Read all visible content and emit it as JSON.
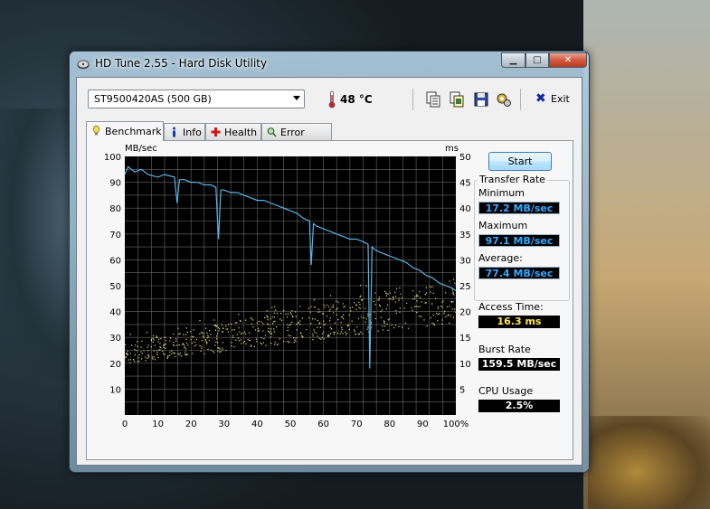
{
  "window": {
    "title": "HD Tune 2.55 - Hard Disk Utility",
    "controls": {
      "minimize": "▁",
      "maximize": "□",
      "close": "✕"
    }
  },
  "toolbar": {
    "drive": "ST9500420AS (500 GB)",
    "temperature": "48 °C",
    "icons": [
      "copy-text-icon",
      "copy-info-icon",
      "save-icon",
      "options-icon"
    ],
    "exit_label": "Exit"
  },
  "tabs": [
    {
      "label": "Benchmark",
      "icon": "benchmark-icon",
      "active": true
    },
    {
      "label": "Info",
      "icon": "info-icon",
      "active": false
    },
    {
      "label": "Health",
      "icon": "health-icon",
      "active": false
    },
    {
      "label": "Error Scan",
      "icon": "error-scan-icon",
      "active": false
    }
  ],
  "benchmark": {
    "start_label": "Start",
    "transfer_rate": {
      "title": "Transfer Rate",
      "minimum_label": "Minimum",
      "minimum": "17.2 MB/sec",
      "maximum_label": "Maximum",
      "maximum": "97.1 MB/sec",
      "average_label": "Average:",
      "average": "77.4 MB/sec"
    },
    "access_time_label": "Access Time:",
    "access_time": "16.3 ms",
    "burst_rate_label": "Burst Rate",
    "burst_rate": "159.5 MB/sec",
    "cpu_usage_label": "CPU Usage",
    "cpu_usage": "2.5%"
  },
  "colors": {
    "plot_bg": "#000000",
    "grid": "#6a6a6a",
    "transfer_line": "#5ab4e6",
    "access_dots": "#e8e07a"
  },
  "chart_data": {
    "type": "line",
    "ylabel_left": "MB/sec",
    "ylabel_right": "ms",
    "x_ticks": [
      "0",
      "10",
      "20",
      "30",
      "40",
      "50",
      "60",
      "70",
      "80",
      "90",
      "100%"
    ],
    "y_left_ticks": [
      "10",
      "20",
      "30",
      "40",
      "50",
      "60",
      "70",
      "80",
      "90",
      "100"
    ],
    "y_right_ticks": [
      "5",
      "10",
      "15",
      "20",
      "25",
      "30",
      "35",
      "40",
      "45",
      "50"
    ],
    "xlim": [
      0,
      100
    ],
    "ylim_left": [
      0,
      100
    ],
    "ylim_right": [
      0,
      50
    ],
    "grid": true,
    "series": [
      {
        "kind": "transfer",
        "x": [
          0,
          1,
          3,
          5,
          7,
          10,
          12,
          15,
          15.8,
          16.5,
          18,
          20,
          22,
          24,
          26,
          27.5,
          28.3,
          29,
          30,
          32,
          34,
          36,
          38,
          40,
          42,
          44,
          46,
          48,
          50,
          52,
          54,
          55.8,
          56.3,
          57,
          58,
          60,
          62,
          64,
          66,
          68,
          70,
          72,
          73.5,
          74,
          74.7,
          75.5,
          77,
          79,
          81,
          83,
          85,
          87,
          89,
          91,
          93,
          95,
          97,
          99,
          100
        ],
        "y": [
          93,
          96,
          94,
          95,
          93,
          92,
          93,
          92,
          82,
          91,
          91,
          90,
          90,
          89,
          89,
          88,
          68,
          87,
          87,
          86,
          86,
          85,
          84,
          83,
          83,
          82,
          81,
          80,
          79,
          78,
          76,
          75,
          58,
          74,
          73,
          72,
          71,
          70,
          69,
          68,
          68,
          67,
          66,
          18,
          65,
          64,
          63,
          62,
          61,
          60,
          59,
          57,
          56,
          54,
          53,
          51,
          50,
          49,
          48
        ]
      }
    ],
    "access_time_band": {
      "x_from": 0,
      "x_to": 100,
      "ms_from_start": [
        10,
        14
      ],
      "ms_from_end": [
        18,
        27
      ]
    }
  }
}
